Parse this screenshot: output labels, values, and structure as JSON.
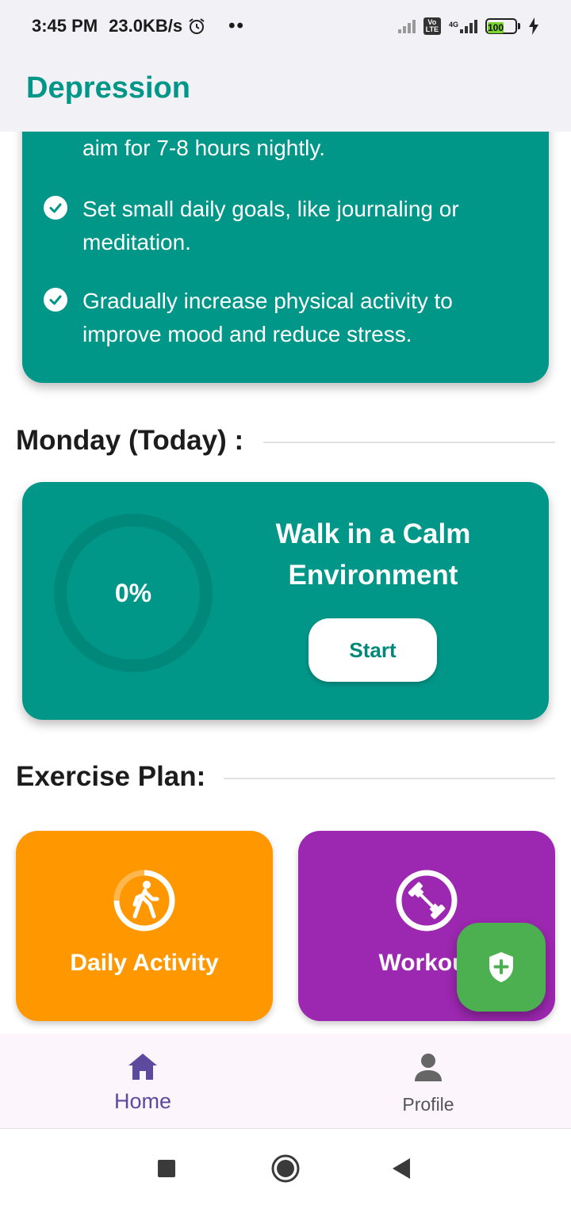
{
  "status_bar": {
    "time": "3:45 PM",
    "speed": "23.0KB/s",
    "dots": "••",
    "volte": "Vo\nLTE",
    "network": "4G",
    "battery": "100"
  },
  "app_bar": {
    "title": "Depression"
  },
  "tips": {
    "partial_text": "aim for 7-8 hours nightly.",
    "items": [
      "Set small daily goals, like journaling or meditation.",
      "Gradually increase physical activity to improve mood and reduce stress."
    ]
  },
  "today": {
    "heading": "Monday (Today) :",
    "progress_label": "0%",
    "progress_fraction": 0,
    "task_title": "Walk in a Calm Environment",
    "start_label": "Start"
  },
  "exercise": {
    "heading": "Exercise Plan:",
    "cards": [
      {
        "label": "Daily Activity",
        "icon": "walking-person-icon",
        "color": "#ff9800"
      },
      {
        "label": "Workout",
        "icon": "dumbbell-icon",
        "color": "#9c27b0"
      }
    ]
  },
  "fab": {
    "icon": "shield-plus-icon",
    "color": "#4caf50"
  },
  "bottom_nav": {
    "items": [
      {
        "label": "Home",
        "icon": "home-icon",
        "selected": true
      },
      {
        "label": "Profile",
        "icon": "person-icon",
        "selected": false
      }
    ]
  },
  "system_nav": {
    "recents": "square-icon",
    "home": "circle-icon",
    "back": "triangle-back-icon"
  },
  "colors": {
    "primary": "#009688",
    "app_bar_bg": "#f2f1f5",
    "nav_selected": "#5b4a9e"
  }
}
